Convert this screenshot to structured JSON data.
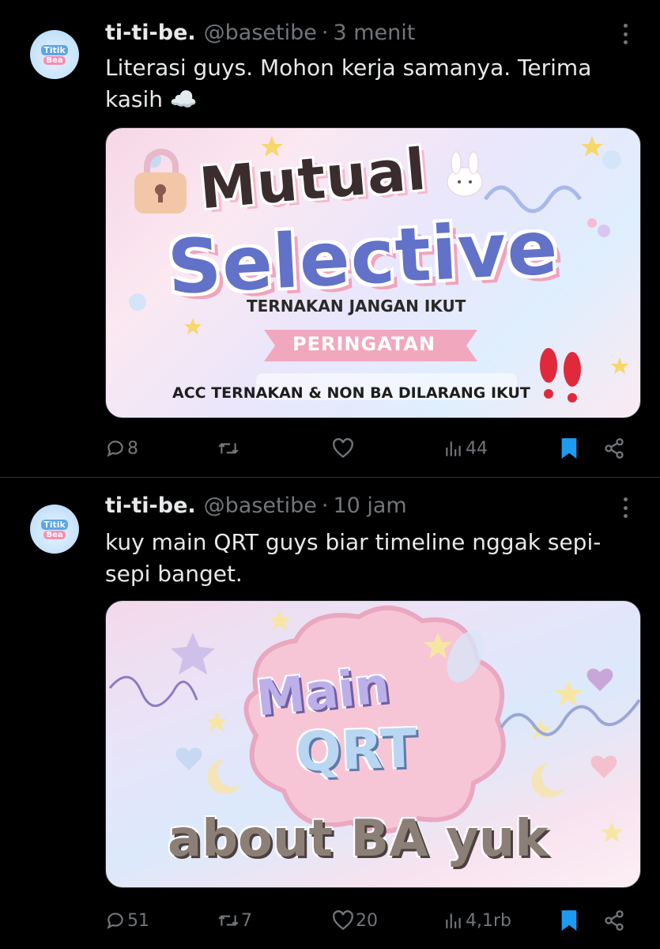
{
  "tweets": [
    {
      "avatar": {
        "line1": "Titik",
        "line2": "Bea"
      },
      "name": "ti-ti-be.",
      "handle": "@basetibe",
      "separator": "·",
      "time": "3 menit",
      "text": "Literasi guys. Mohon kerja samanya. Terima kasih ☁️",
      "media": {
        "title_top": "Mutual",
        "title_main": "Selective",
        "subtitle": "TERNAKAN JANGAN IKUT",
        "ribbon": "PERINGATAN",
        "footer": "ACC TERNAKAN & NON BA DILARANG IKUT",
        "exclaim": "!!"
      },
      "stats": {
        "replies": "8",
        "reposts": "",
        "likes": "",
        "views": "44"
      }
    },
    {
      "avatar": {
        "line1": "Titik",
        "line2": "Bea"
      },
      "name": "ti-ti-be.",
      "handle": "@basetibe",
      "separator": "·",
      "time": "10 jam",
      "text": "kuy main QRT guys biar timeline nggak sepi-sepi banget.",
      "media": {
        "line1": "Main",
        "line2": "QRT",
        "line3": "about BA yuk"
      },
      "stats": {
        "replies": "51",
        "reposts": "7",
        "likes": "20",
        "views": "4,1rb"
      }
    }
  ],
  "colors": {
    "background": "#000000",
    "text": "#e7e9ea",
    "muted": "#71767b",
    "bookmark": "#1d9bf0"
  },
  "icons": [
    "more-icon",
    "reply-icon",
    "repost-icon",
    "like-icon",
    "views-icon",
    "bookmark-icon",
    "share-icon"
  ]
}
